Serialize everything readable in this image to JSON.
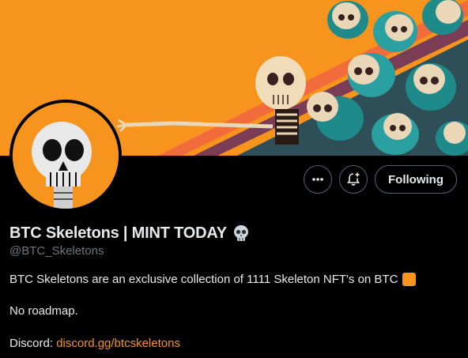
{
  "profile": {
    "display_name": "BTC Skeletons | MINT TODAY",
    "name_emoji": "skull-emoji",
    "handle": "@BTC_Skeletons",
    "bio": "BTC Skeletons are an exclusive collection of 1111 Skeleton NFT's on BTC",
    "bio_emoji": "orange-square-emoji",
    "line2": "No roadmap.",
    "discord_label": "Discord:",
    "discord_link": "discord.gg/btcskeletons"
  },
  "actions": {
    "more_icon": "more-icon",
    "notify_icon": "notification-bell-plus-icon",
    "follow_label": "Following"
  },
  "colors": {
    "accent": "#f7941d",
    "background": "#000000",
    "text": "#e7e9ea",
    "muted": "#71767b",
    "border": "#536471"
  }
}
